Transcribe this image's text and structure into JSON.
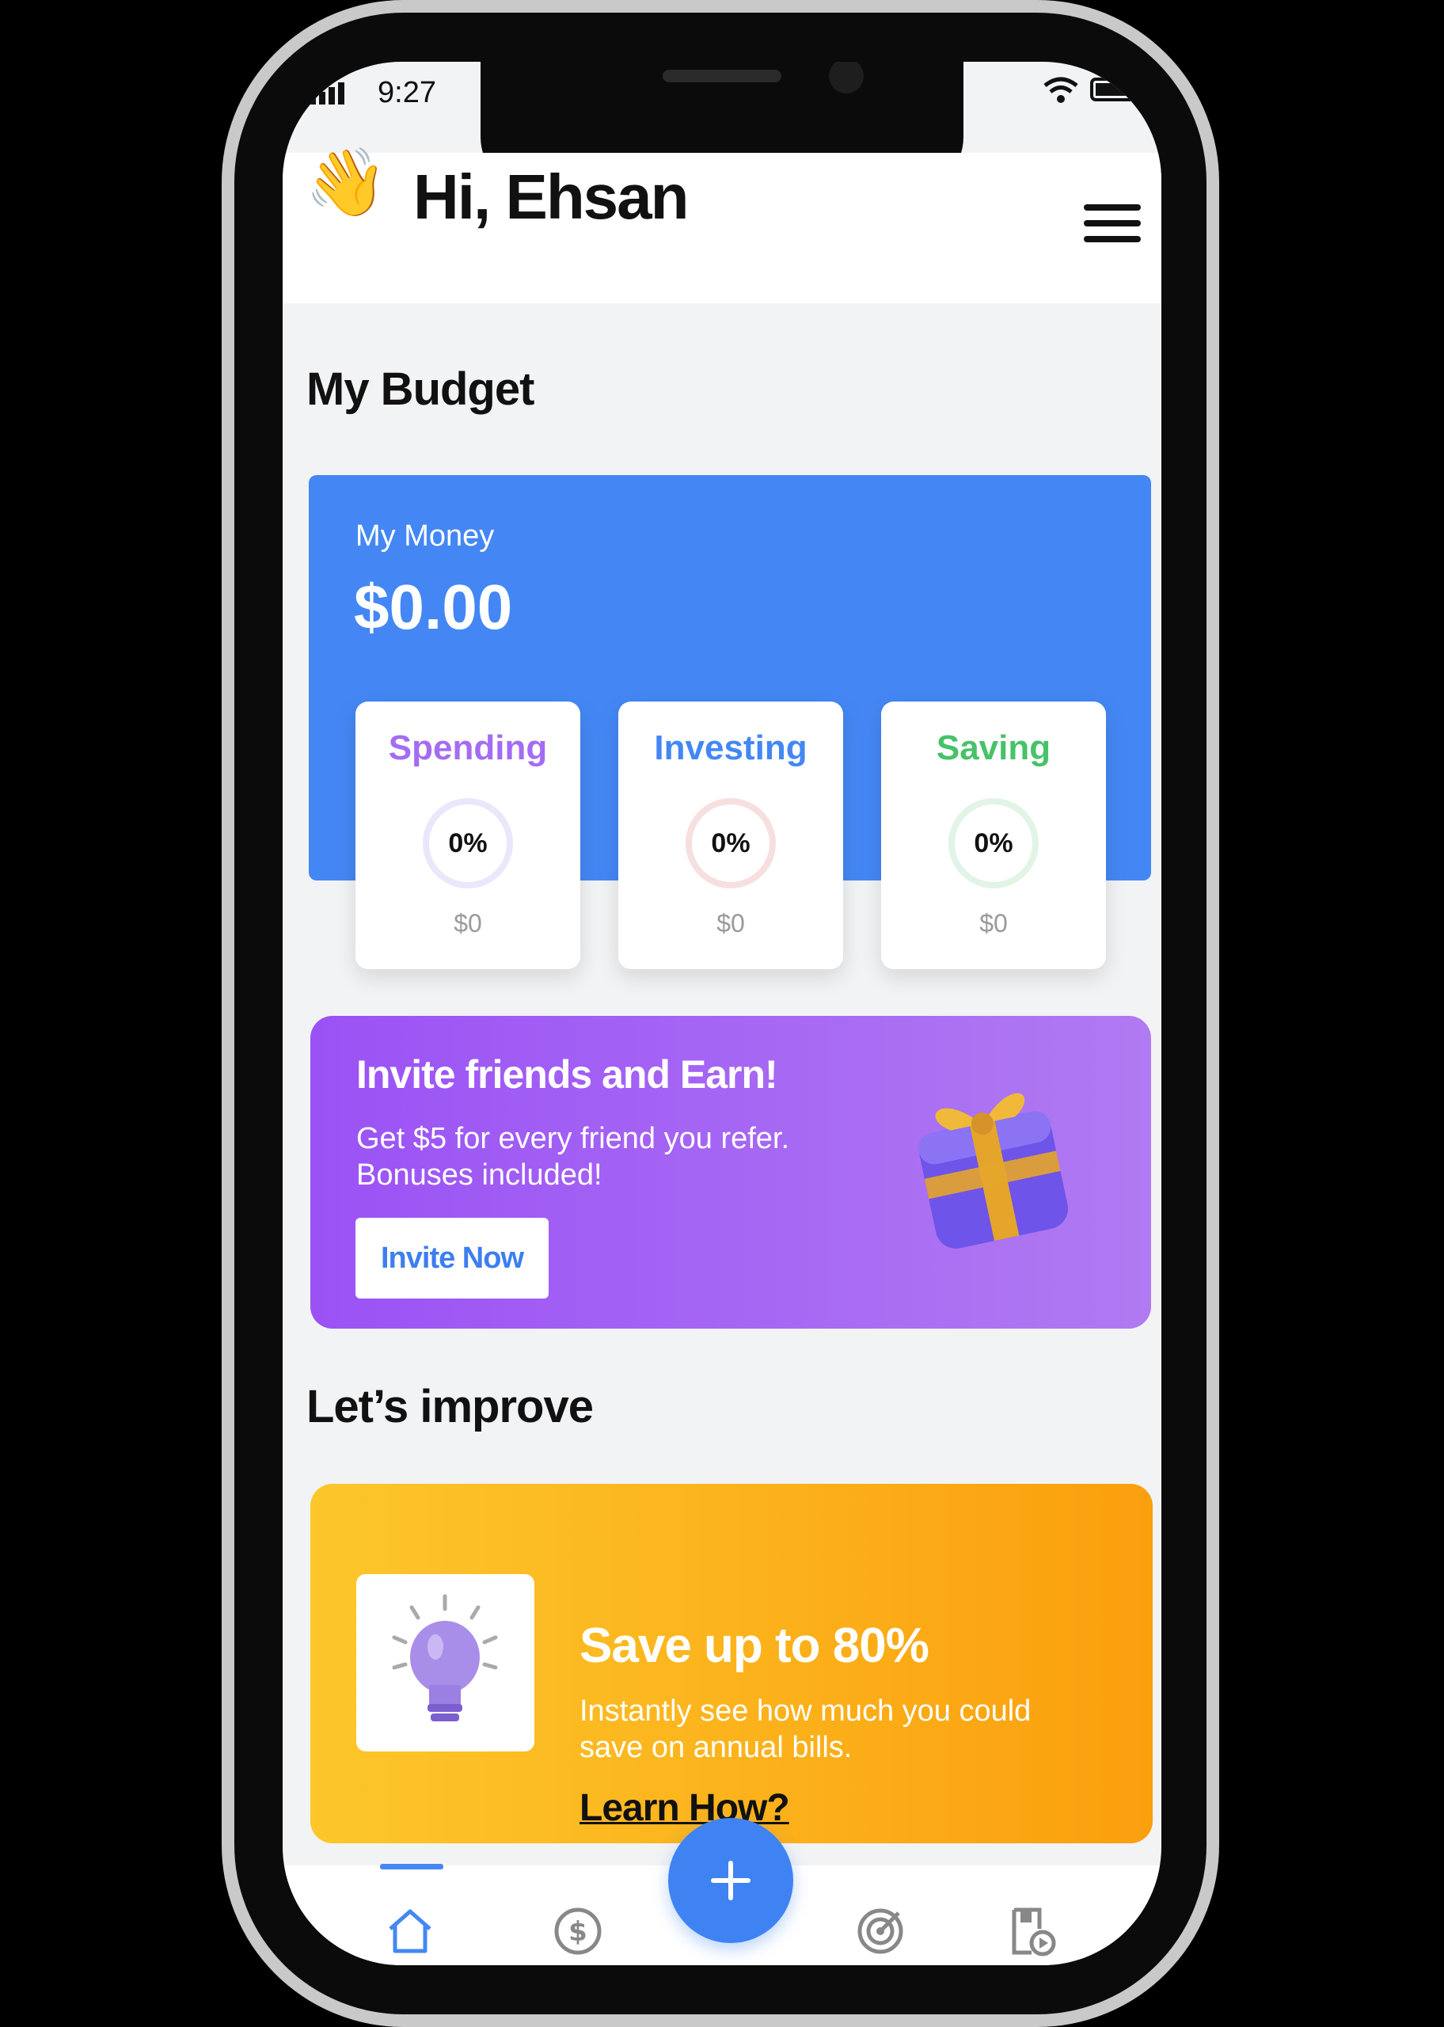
{
  "status_bar": {
    "time": "9:27"
  },
  "header": {
    "greeting": "Hi, Ehsan",
    "wave_icon": "waving-hand-icon",
    "menu_icon": "hamburger-menu-icon"
  },
  "budget": {
    "title": "My Budget",
    "money_label": "My Money",
    "money_amount": "$0.00",
    "categories": [
      {
        "name": "Spending",
        "percent": "0%",
        "amount": "$0",
        "color": "#a46cf4",
        "ring_color": "#ece6fb"
      },
      {
        "name": "Investing",
        "percent": "0%",
        "amount": "$0",
        "color": "#4487f4",
        "ring_color": "#f7dfe0"
      },
      {
        "name": "Saving",
        "percent": "0%",
        "amount": "$0",
        "color": "#47c26a",
        "ring_color": "#e1f4e5"
      }
    ]
  },
  "invite": {
    "title": "Invite friends and Earn!",
    "text": "Get $5 for every friend you refer. Bonuses included!",
    "button": "Invite Now",
    "icon": "gift-icon"
  },
  "improve": {
    "title": "Let’s improve",
    "card_title": "Save up to 80%",
    "card_text": "Instantly see how much you could save on annual bills.",
    "link": "Learn How?",
    "icon": "lightbulb-icon"
  },
  "nav": {
    "items": [
      "home-icon",
      "dollar-icon",
      "target-icon",
      "document-play-icon"
    ],
    "fab_icon": "plus-icon",
    "active": "home-icon"
  },
  "colors": {
    "primary": "#4487f4",
    "purple": "#9b52f5",
    "orange": "#fb9f0d"
  }
}
